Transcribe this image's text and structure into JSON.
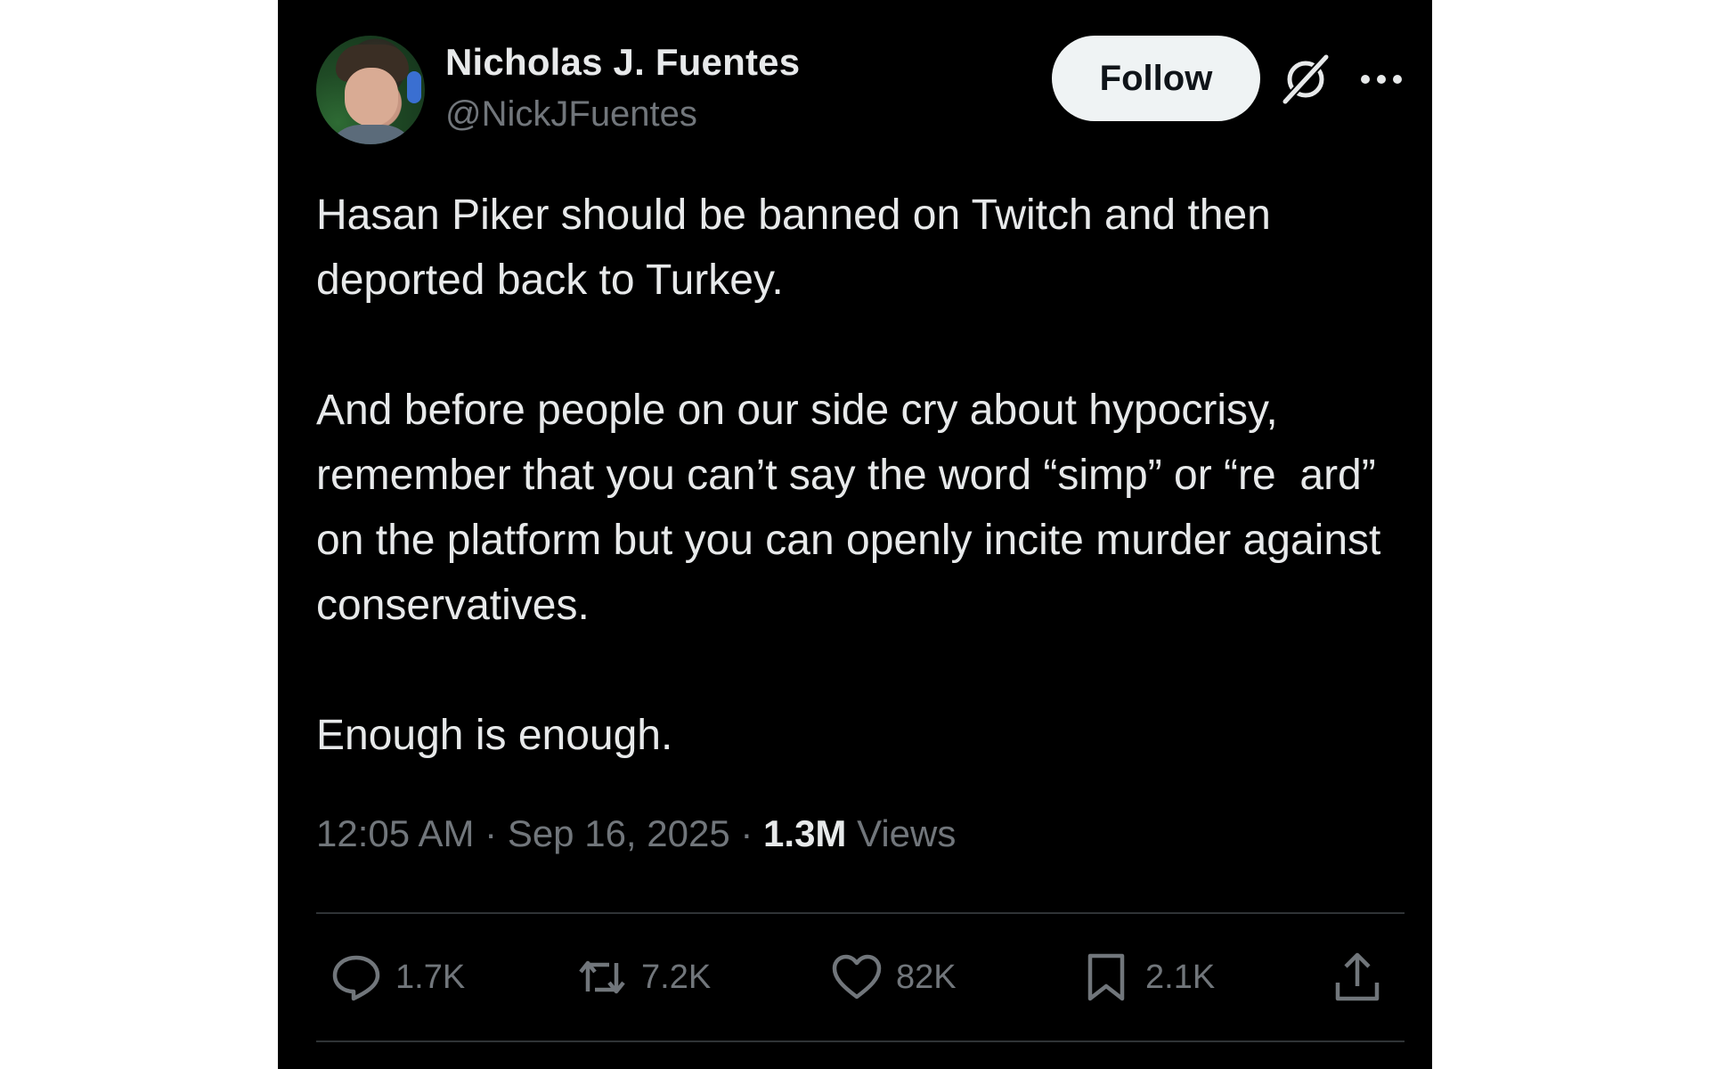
{
  "author": {
    "display_name": "Nicholas J. Fuentes",
    "handle": "@NickJFuentes"
  },
  "header": {
    "follow_label": "Follow"
  },
  "tweet": {
    "text": "Hasan Piker should be banned on Twitch and then deported back to Turkey.\n\nAnd before people on our side cry about hypocrisy, remember that you can’t say the word “simp” or “re  ard” on the platform but you can openly incite murder against conservatives.\n\nEnough is enough.",
    "time": "12:05 AM",
    "separator": "·",
    "date": "Sep 16, 2025",
    "views_count": "1.3M",
    "views_label": "Views"
  },
  "actions": {
    "replies": "1.7K",
    "reposts": "7.2K",
    "likes": "82K",
    "bookmarks": "2.1K"
  },
  "icons": {
    "grok": "grok-icon",
    "more": "more-icon",
    "reply": "reply-icon",
    "repost": "repost-icon",
    "like": "heart-icon",
    "bookmark": "bookmark-icon",
    "share": "share-icon"
  },
  "colors": {
    "background": "#000000",
    "text_primary": "#e7e9ea",
    "text_secondary": "#71767b",
    "divider": "#2f3336",
    "follow_button_bg": "#eff3f4"
  }
}
